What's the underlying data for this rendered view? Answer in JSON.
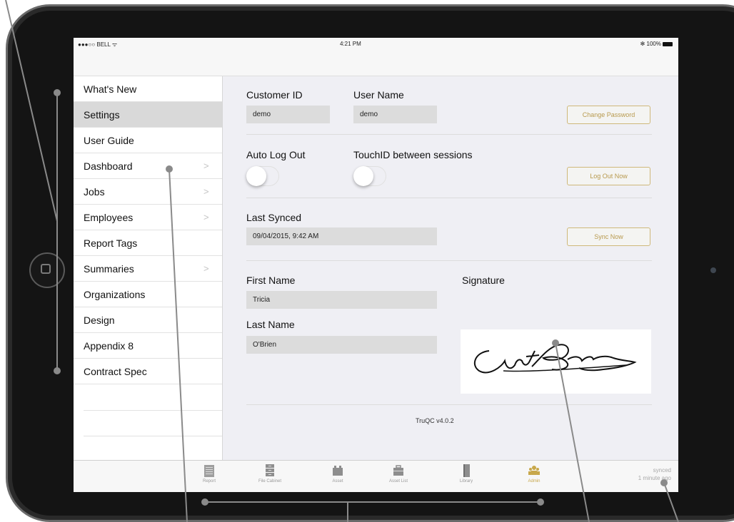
{
  "status_bar": {
    "carrier": "●●●○○ BELL ᯤ",
    "time": "4:21 PM",
    "battery": "✻ 100%"
  },
  "sidebar": {
    "items": [
      {
        "label": "What's New",
        "chevron": false,
        "selected": false
      },
      {
        "label": "Settings",
        "chevron": false,
        "selected": true
      },
      {
        "label": "User Guide",
        "chevron": false,
        "selected": false
      },
      {
        "label": "Dashboard",
        "chevron": true,
        "selected": false
      },
      {
        "label": "Jobs",
        "chevron": true,
        "selected": false
      },
      {
        "label": "Employees",
        "chevron": true,
        "selected": false
      },
      {
        "label": "Report Tags",
        "chevron": false,
        "selected": false
      },
      {
        "label": "Summaries",
        "chevron": true,
        "selected": false
      },
      {
        "label": "Organizations",
        "chevron": false,
        "selected": false
      },
      {
        "label": "Design",
        "chevron": false,
        "selected": false
      },
      {
        "label": "Appendix 8",
        "chevron": false,
        "selected": false
      },
      {
        "label": "Contract Spec",
        "chevron": false,
        "selected": false
      }
    ],
    "chevron_glyph": ">"
  },
  "settings": {
    "customer_id_label": "Customer ID",
    "customer_id_value": "demo",
    "user_name_label": "User Name",
    "user_name_value": "demo",
    "change_password_button": "Change Password",
    "auto_logout_label": "Auto Log Out",
    "touchid_label": "TouchID between sessions",
    "logout_now_button": "Log Out Now",
    "last_synced_label": "Last Synced",
    "last_synced_value": "09/04/2015, 9:42 AM",
    "sync_now_button": "Sync Now",
    "first_name_label": "First Name",
    "first_name_value": "Tricia",
    "last_name_label": "Last Name",
    "last_name_value": "O'Brien",
    "signature_label": "Signature",
    "version": "TruQC v4.0.2"
  },
  "tabbar": {
    "tabs": [
      {
        "label": "Report",
        "icon": "notepad-icon",
        "active": false
      },
      {
        "label": "File Cabinet",
        "icon": "file-cabinet-icon",
        "active": false
      },
      {
        "label": "Asset",
        "icon": "asset-icon",
        "active": false
      },
      {
        "label": "Asset List",
        "icon": "briefcase-icon",
        "active": false
      },
      {
        "label": "Library",
        "icon": "book-icon",
        "active": false
      },
      {
        "label": "Admin",
        "icon": "people-icon",
        "active": true
      }
    ],
    "sync_status_line1": "synced",
    "sync_status_line2": "1 minute ago"
  },
  "colors": {
    "accent_gold": "#c8a84b",
    "selected_row": "#d9d9d9",
    "background": "#efeff4"
  }
}
